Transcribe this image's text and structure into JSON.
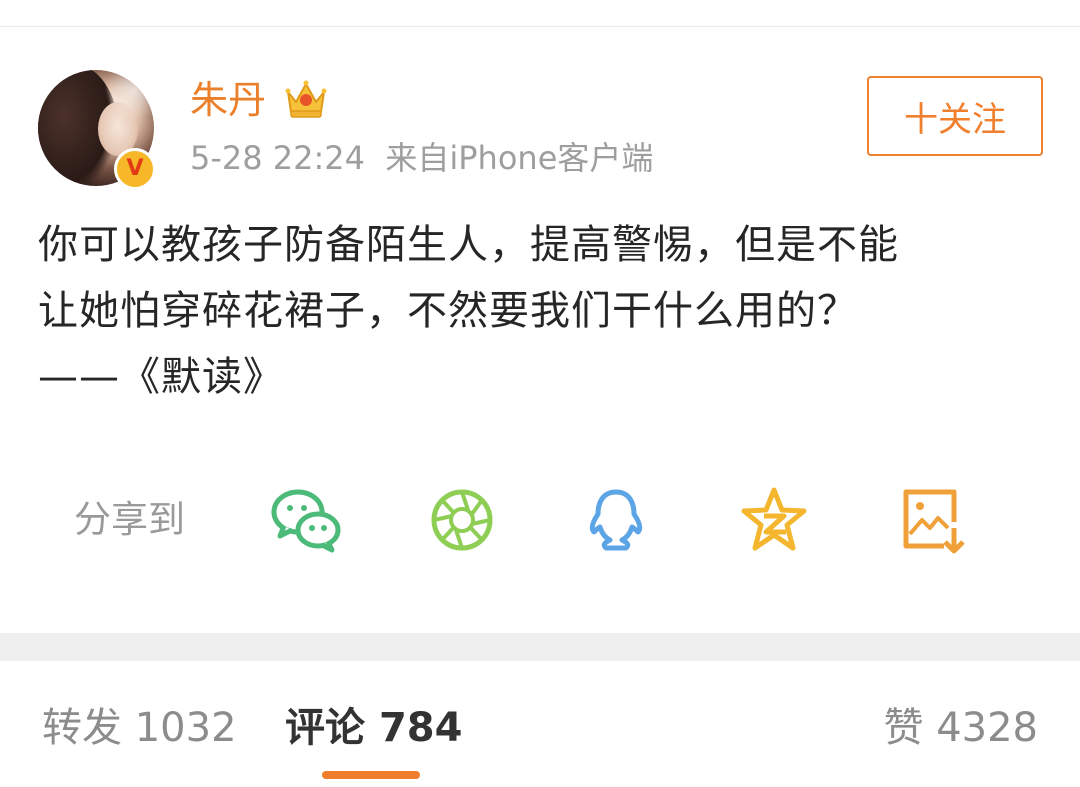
{
  "post": {
    "author": {
      "name": "朱丹",
      "verified_badge": "V"
    },
    "timestamp": "5-28 22:24",
    "source": "来自iPhone客户端",
    "follow_label": "十关注",
    "text_lines": [
      "你可以教孩子防备陌生人，提高警惕，但是不能",
      "让她怕穿碎花裙子，不然要我们干什么用的？",
      "——《默读》"
    ]
  },
  "share": {
    "label": "分享到",
    "icons": [
      "wechat-icon",
      "moments-icon",
      "qq-icon",
      "qzone-icon",
      "save-image-icon"
    ]
  },
  "tabs": [
    {
      "label": "转发",
      "count": "1032"
    },
    {
      "label": "评论",
      "count": "784"
    },
    {
      "label": "赞",
      "count": "4328"
    }
  ],
  "colors": {
    "accent": "#ef7d2b",
    "wechat": "#4cbb7a",
    "moments": "#8fce55",
    "qq": "#5ba4e6",
    "qzone": "#f4b62e",
    "save": "#f0a038"
  }
}
